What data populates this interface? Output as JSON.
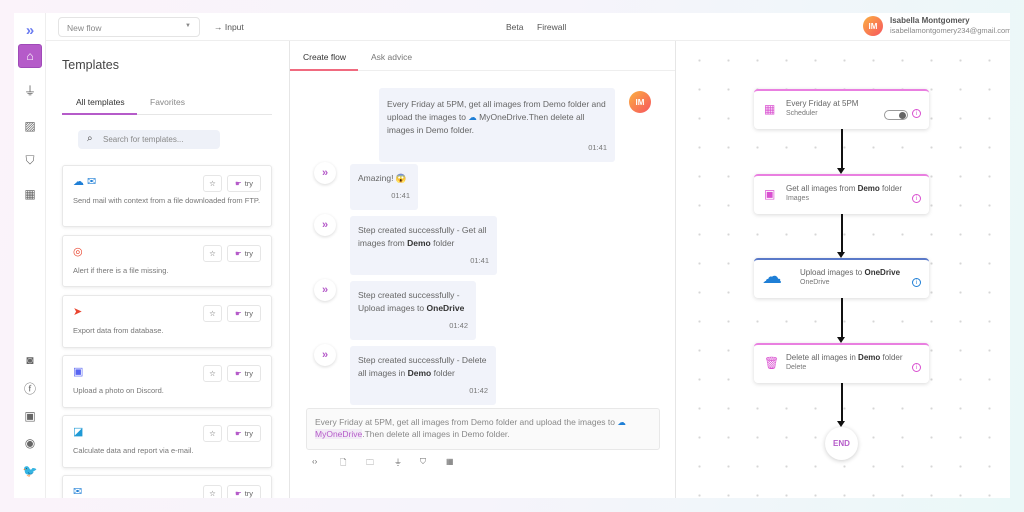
{
  "sidebar": {
    "top_icons": [
      "logo-icon",
      "home-icon",
      "plug-icon",
      "image-icon",
      "shield-icon",
      "dashboard-icon"
    ],
    "bottom_icons": [
      "discord-icon",
      "facebook-icon",
      "linkedin-icon",
      "reddit-icon",
      "twitter-icon"
    ]
  },
  "topbar": {
    "flow_select": "New flow",
    "input_label": "→ Input",
    "beta": "Beta",
    "firewall": "Firewall",
    "user_initials": "IM",
    "user_name": "Isabella Montgomery",
    "user_email": "isabellamontgomery234@gmail.com"
  },
  "templates": {
    "title": "Templates",
    "tabs": [
      "All templates",
      "Favorites"
    ],
    "search_placeholder": "Search for templates...",
    "try_label": "try",
    "star": "☆",
    "cards": [
      {
        "icons": "☁ ✉",
        "text": "Send mail with context from a file downloaded from FTP."
      },
      {
        "icons": "◎",
        "text": "Alert if there is a file missing."
      },
      {
        "icons": "➤",
        "text": "Export data from database."
      },
      {
        "icons": "▣",
        "text": "Upload a photo on Discord."
      },
      {
        "icons": "◪",
        "text": "Calculate data and report via e-mail."
      },
      {
        "icons": "✉",
        "text": ""
      }
    ]
  },
  "chat": {
    "tabs": [
      "Create flow",
      "Ask advice"
    ],
    "user_msg": {
      "part1": "Every Friday at 5PM, get all images from Demo folder and upload the images to ",
      "link": "MyOneDrive",
      "part2": ".Then delete all images in Demo folder.",
      "time": "01:41",
      "initials": "IM"
    },
    "bot_msgs": [
      {
        "pre": "Amazing! 😱",
        "bold": "",
        "post": "",
        "time": "01:41"
      },
      {
        "pre": "Step created successfully - Get all images from ",
        "bold": "Demo",
        "post": " folder",
        "time": "01:41"
      },
      {
        "pre": "Step created successfully - Upload images to ",
        "bold": "OneDrive",
        "post": "",
        "time": "01:42"
      },
      {
        "pre": "Step created successfully - Delete all images in ",
        "bold": "Demo",
        "post": " folder",
        "time": "01:42"
      }
    ],
    "input": {
      "part1": "Every Friday at 5PM, get all images from Demo folder and upload the images to ",
      "link": "MyOneDrive",
      "part2": ".Then delete all images in Demo folder."
    },
    "tools": [
      "‹›",
      "🗋",
      "🗀",
      "⏚",
      "⛉",
      "▦"
    ]
  },
  "flow": {
    "nodes": [
      {
        "pre": "Every Friday at 5PM",
        "bold": "",
        "post": "",
        "sub": "Scheduler",
        "toggle": true
      },
      {
        "pre": "Get all images from ",
        "bold": "Demo",
        "post": " folder",
        "sub": "Images"
      },
      {
        "pre": "Upload images to ",
        "bold": "OneDrive",
        "post": "",
        "sub": "OneDrive"
      },
      {
        "pre": "Delete all images in ",
        "bold": "Demo",
        "post": " folder",
        "sub": "Delete"
      }
    ],
    "end_label": "END"
  },
  "colors": {
    "accent": "#b55bc9",
    "node_border": "#e97fe0",
    "onedrive": "#1f7fd6"
  }
}
